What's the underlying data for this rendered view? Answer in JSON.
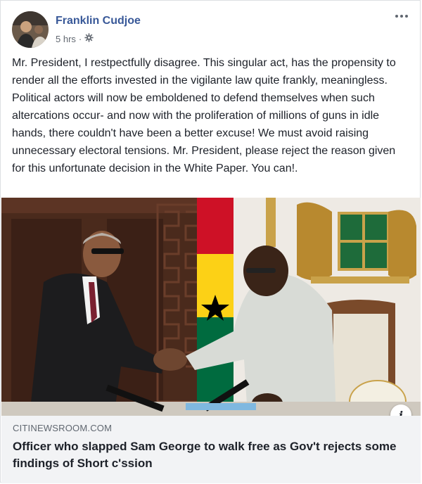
{
  "post": {
    "author": "Franklin Cudjoe",
    "time": "5 hrs",
    "separator": "·",
    "text": "Mr. President, I restpectfully disagree. This singular act, has the propensity to render all the efforts invested in the vigilante law quite frankly, meaningless. Political actors will now be emboldened to defend themselves when such altercations occur- and now with the proliferation of millions of guns in idle hands, there couldn't have been a better excuse! We must avoid raising unnecessary electoral tensions. Mr. President, please reject the reason given for this unfortunate decision in the White Paper. You can!."
  },
  "link": {
    "domain": "CITINEWSROOM.COM",
    "headline": "Officer who slapped Sam George to walk free as Gov't rejects some findings of Short c'ssion",
    "info_glyph": "i"
  },
  "icons": {
    "privacy": "gear-icon",
    "more": "more-options-icon",
    "info": "info-icon"
  },
  "colors": {
    "author": "#385898",
    "meta": "#616770",
    "link_bg": "#f2f3f5",
    "ghana_red": "#ce1126",
    "ghana_gold": "#fcd116",
    "ghana_green": "#006b3f"
  }
}
